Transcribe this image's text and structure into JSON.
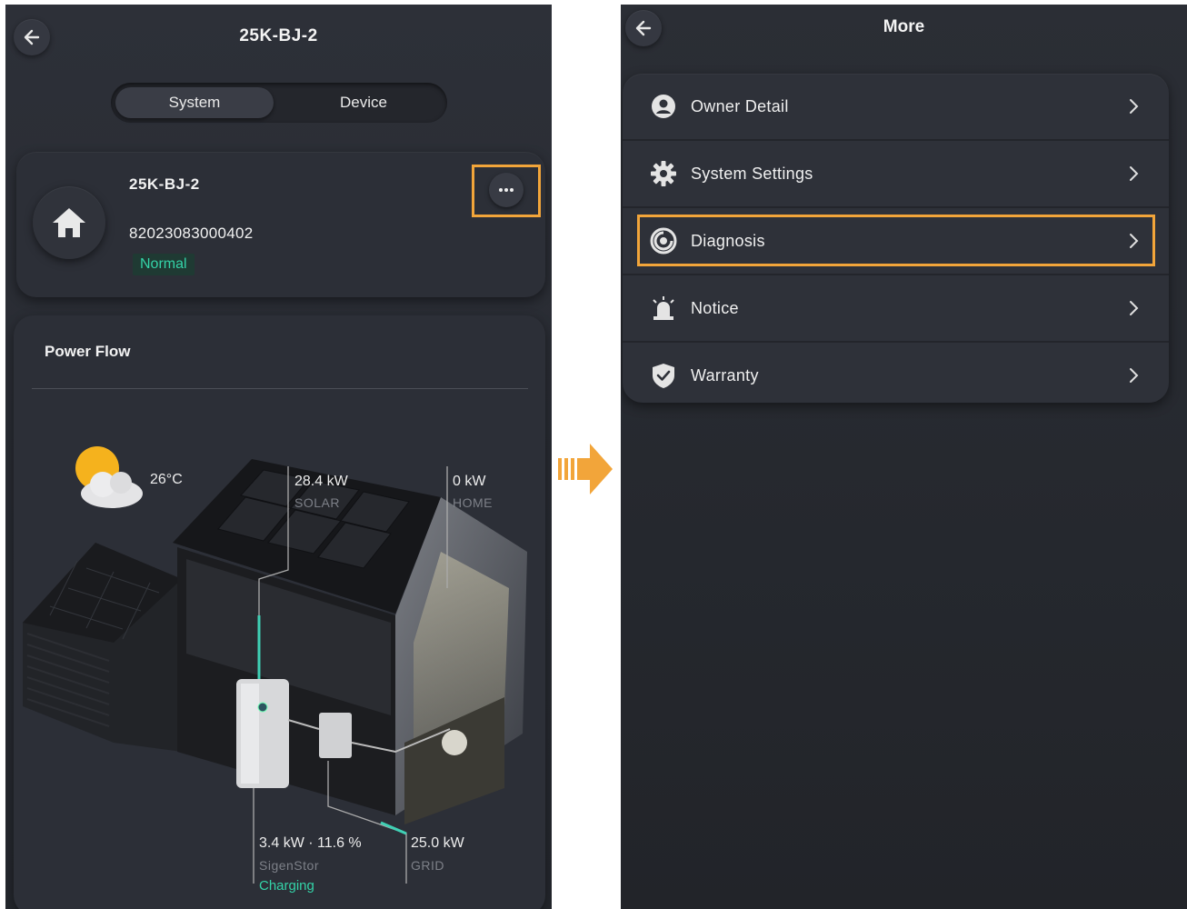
{
  "left": {
    "title": "25K-BJ-2",
    "tabs": [
      "System",
      "Device"
    ],
    "system": {
      "name": "25K-BJ-2",
      "serial": "82023083000402",
      "status": "Normal"
    },
    "power_flow": {
      "title": "Power Flow",
      "weather": {
        "temperature": "26°C",
        "icon": "partly-cloudy-icon"
      },
      "solar": {
        "value": "28.4 kW",
        "label": "SOLAR"
      },
      "home": {
        "value": "0 kW",
        "label": "HOME"
      },
      "battery": {
        "value": "3.4 kW · 11.6 %",
        "label": "SigenStor",
        "state": "Charging"
      },
      "grid": {
        "value": "25.0 kW",
        "label": "GRID"
      }
    }
  },
  "right": {
    "title": "More",
    "menu": [
      {
        "label": "Owner Detail",
        "icon": "user-icon"
      },
      {
        "label": "System Settings",
        "icon": "gear-icon"
      },
      {
        "label": "Diagnosis",
        "icon": "diagnosis-icon"
      },
      {
        "label": "Notice",
        "icon": "alarm-icon"
      },
      {
        "label": "Warranty",
        "icon": "shield-icon"
      }
    ]
  },
  "colors": {
    "accent_highlight": "#f2a53a",
    "status_green": "#34d3a8",
    "background": "#2b2e35"
  }
}
